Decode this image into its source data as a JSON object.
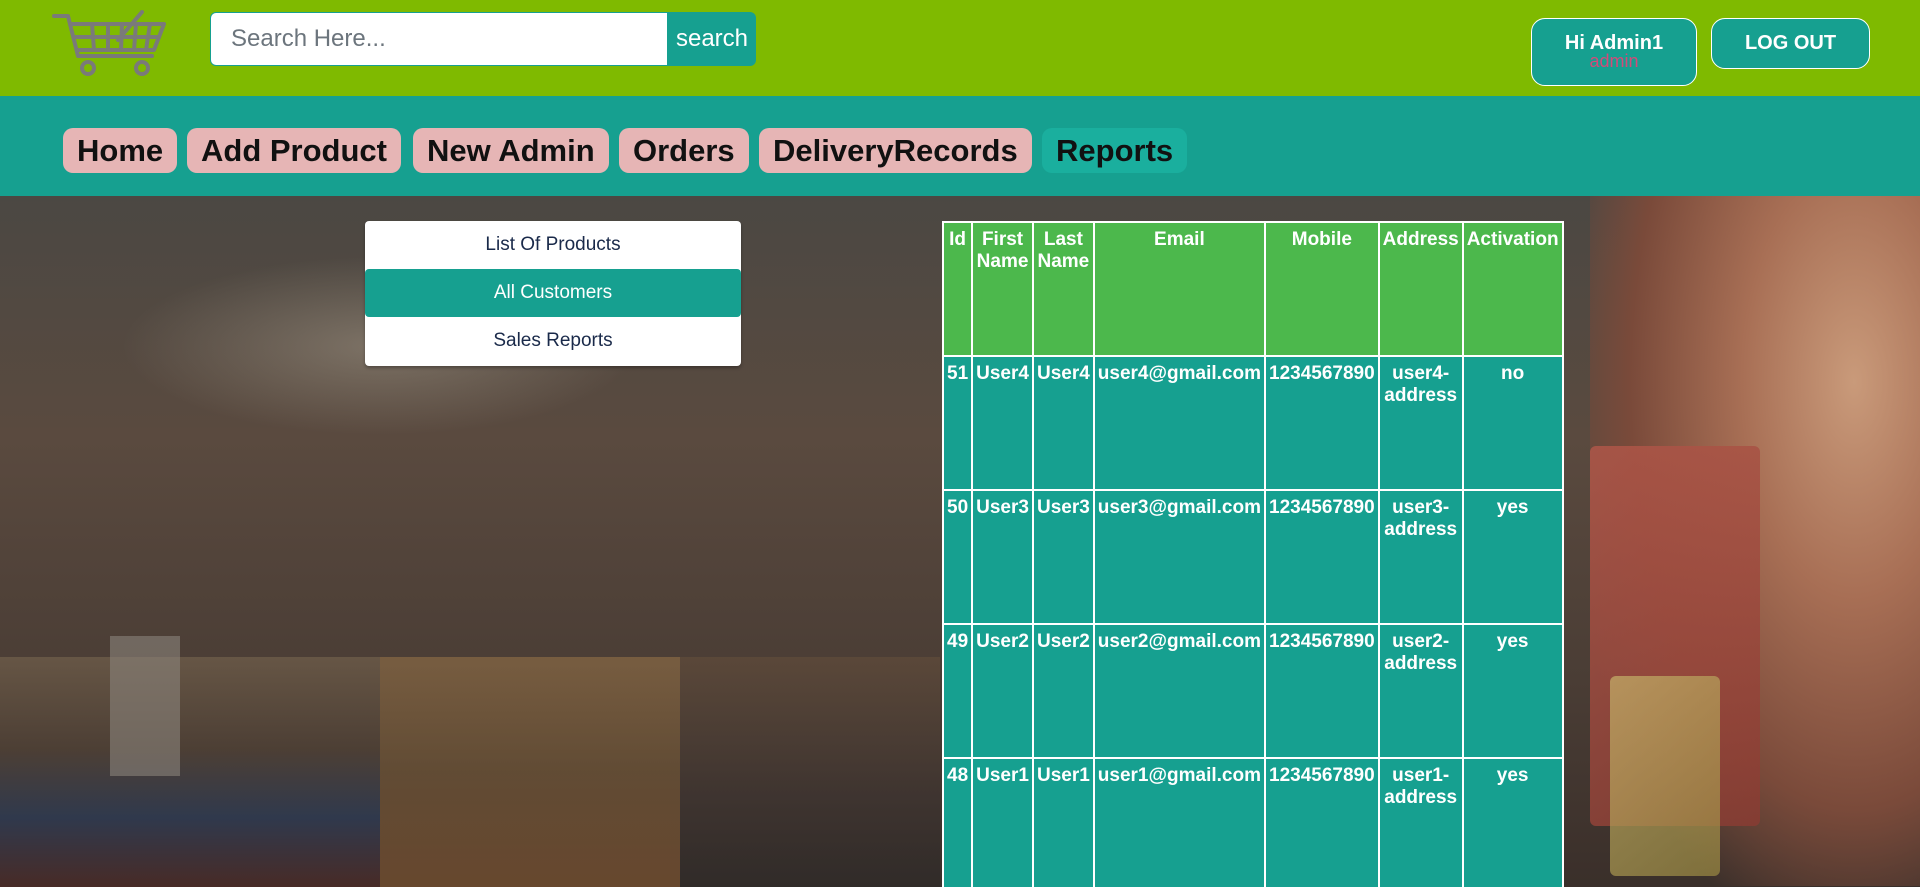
{
  "header": {
    "search_placeholder": "Search Here...",
    "search_label": "search",
    "greeting": "Hi Admin1",
    "role": "admin",
    "logout_label": "LOG OUT"
  },
  "nav": {
    "items": [
      {
        "label": "Home"
      },
      {
        "label": "Add Product"
      },
      {
        "label": "New Admin"
      },
      {
        "label": "Orders"
      },
      {
        "label": "DeliveryRecords"
      },
      {
        "label": "Reports"
      }
    ],
    "active": "Reports"
  },
  "side_menu": {
    "items": [
      {
        "label": "List Of Products"
      },
      {
        "label": "All Customers"
      },
      {
        "label": "Sales Reports"
      }
    ],
    "active": "All Customers"
  },
  "table": {
    "headers": {
      "id": "Id",
      "first_name": "First Name",
      "last_name": "Last Name",
      "email": "Email",
      "mobile": "Mobile",
      "address": "Address",
      "activation": "Activation"
    },
    "rows": [
      {
        "id": "51",
        "first_name": "User4",
        "last_name": "User4",
        "email": "user4@gmail.com",
        "mobile": "1234567890",
        "address": "user4-address",
        "activation": "no"
      },
      {
        "id": "50",
        "first_name": "User3",
        "last_name": "User3",
        "email": "user3@gmail.com",
        "mobile": "1234567890",
        "address": "user3-address",
        "activation": "yes"
      },
      {
        "id": "49",
        "first_name": "User2",
        "last_name": "User2",
        "email": "user2@gmail.com",
        "mobile": "1234567890",
        "address": "user2-address",
        "activation": "yes"
      },
      {
        "id": "48",
        "first_name": "User1",
        "last_name": "User1",
        "email": "user1@gmail.com",
        "mobile": "1234567890",
        "address": "user1-address",
        "activation": "yes"
      }
    ]
  },
  "colors": {
    "header_green": "#7fba00",
    "teal": "#16a090",
    "nav_pink": "#e6b5b5",
    "table_header_green": "#4cb84c",
    "role_pink": "#d24b7a"
  },
  "icons": {
    "logo": "shopping-cart-icon"
  }
}
